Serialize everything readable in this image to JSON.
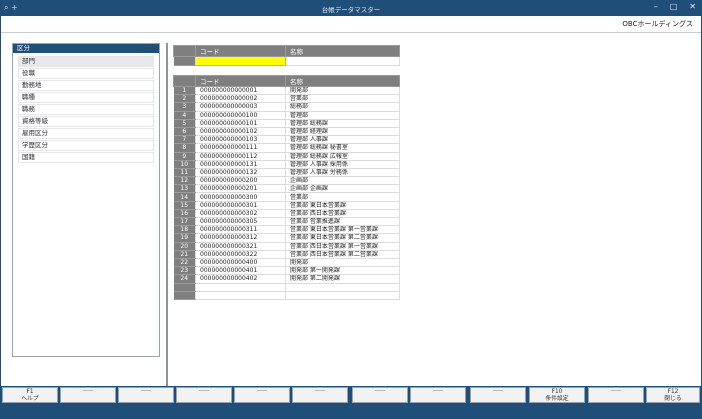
{
  "window": {
    "title": "台帳データマスター",
    "icons": "⌕ +"
  },
  "header": {
    "company": "OBCホールディングス"
  },
  "category_panel": {
    "title": "区分",
    "items": [
      "部門",
      "役職",
      "勤務地",
      "職種",
      "職務",
      "資格等級",
      "雇用区分",
      "学歴区分",
      "国籍"
    ]
  },
  "condition_grid": {
    "col_code": "コード",
    "col_name": "名称",
    "code_value": "",
    "name_value": ""
  },
  "department_grid": {
    "col_code": "コード",
    "col_name": "名称",
    "rows": [
      {
        "no": "1",
        "code": "000000000000001",
        "name": "開発部"
      },
      {
        "no": "2",
        "code": "000000000000002",
        "name": "営業部"
      },
      {
        "no": "3",
        "code": "000000000000003",
        "name": "総務部"
      },
      {
        "no": "4",
        "code": "000000000000100",
        "name": "管理部"
      },
      {
        "no": "5",
        "code": "000000000000101",
        "name": "管理部 総務課"
      },
      {
        "no": "6",
        "code": "000000000000102",
        "name": "管理部 経理課"
      },
      {
        "no": "7",
        "code": "000000000000103",
        "name": "管理部 人事課"
      },
      {
        "no": "8",
        "code": "000000000000111",
        "name": "管理部 総務課 秘書室"
      },
      {
        "no": "9",
        "code": "000000000000112",
        "name": "管理部 総務課 広報室"
      },
      {
        "no": "10",
        "code": "000000000000131",
        "name": "管理部 人事課 採用係"
      },
      {
        "no": "11",
        "code": "000000000000132",
        "name": "管理部 人事課 労務係"
      },
      {
        "no": "12",
        "code": "000000000000200",
        "name": "企画部"
      },
      {
        "no": "13",
        "code": "000000000000201",
        "name": "企画部 企画課"
      },
      {
        "no": "14",
        "code": "000000000000300",
        "name": "営業部"
      },
      {
        "no": "15",
        "code": "000000000000301",
        "name": "営業部 東日本営業課"
      },
      {
        "no": "16",
        "code": "000000000000302",
        "name": "営業部 西日本営業課"
      },
      {
        "no": "17",
        "code": "000000000000305",
        "name": "営業部 営業推進課"
      },
      {
        "no": "18",
        "code": "000000000000311",
        "name": "営業部 東日本営業課 第一営業課"
      },
      {
        "no": "19",
        "code": "000000000000312",
        "name": "営業部 東日本営業課 第二営業課"
      },
      {
        "no": "20",
        "code": "000000000000321",
        "name": "営業部 西日本営業課 第一営業課"
      },
      {
        "no": "21",
        "code": "000000000000322",
        "name": "営業部 西日本営業課 第二営業課"
      },
      {
        "no": "22",
        "code": "000000000000400",
        "name": "開発部"
      },
      {
        "no": "23",
        "code": "000000000000401",
        "name": "開発部 第一開発課"
      },
      {
        "no": "24",
        "code": "000000000000402",
        "name": "開発部 第二開発課"
      }
    ]
  },
  "function_keys": [
    {
      "key": "F1",
      "label": "ヘルプ"
    },
    {
      "key": "",
      "label": ""
    },
    {
      "key": "",
      "label": ""
    },
    {
      "key": "",
      "label": ""
    },
    {
      "key": "",
      "label": ""
    },
    {
      "key": "",
      "label": ""
    },
    {
      "key": "",
      "label": ""
    },
    {
      "key": "",
      "label": ""
    },
    {
      "key": "",
      "label": ""
    },
    {
      "key": "F10",
      "label": "条件設定"
    },
    {
      "key": "",
      "label": ""
    },
    {
      "key": "F12",
      "label": "閉じる"
    }
  ]
}
